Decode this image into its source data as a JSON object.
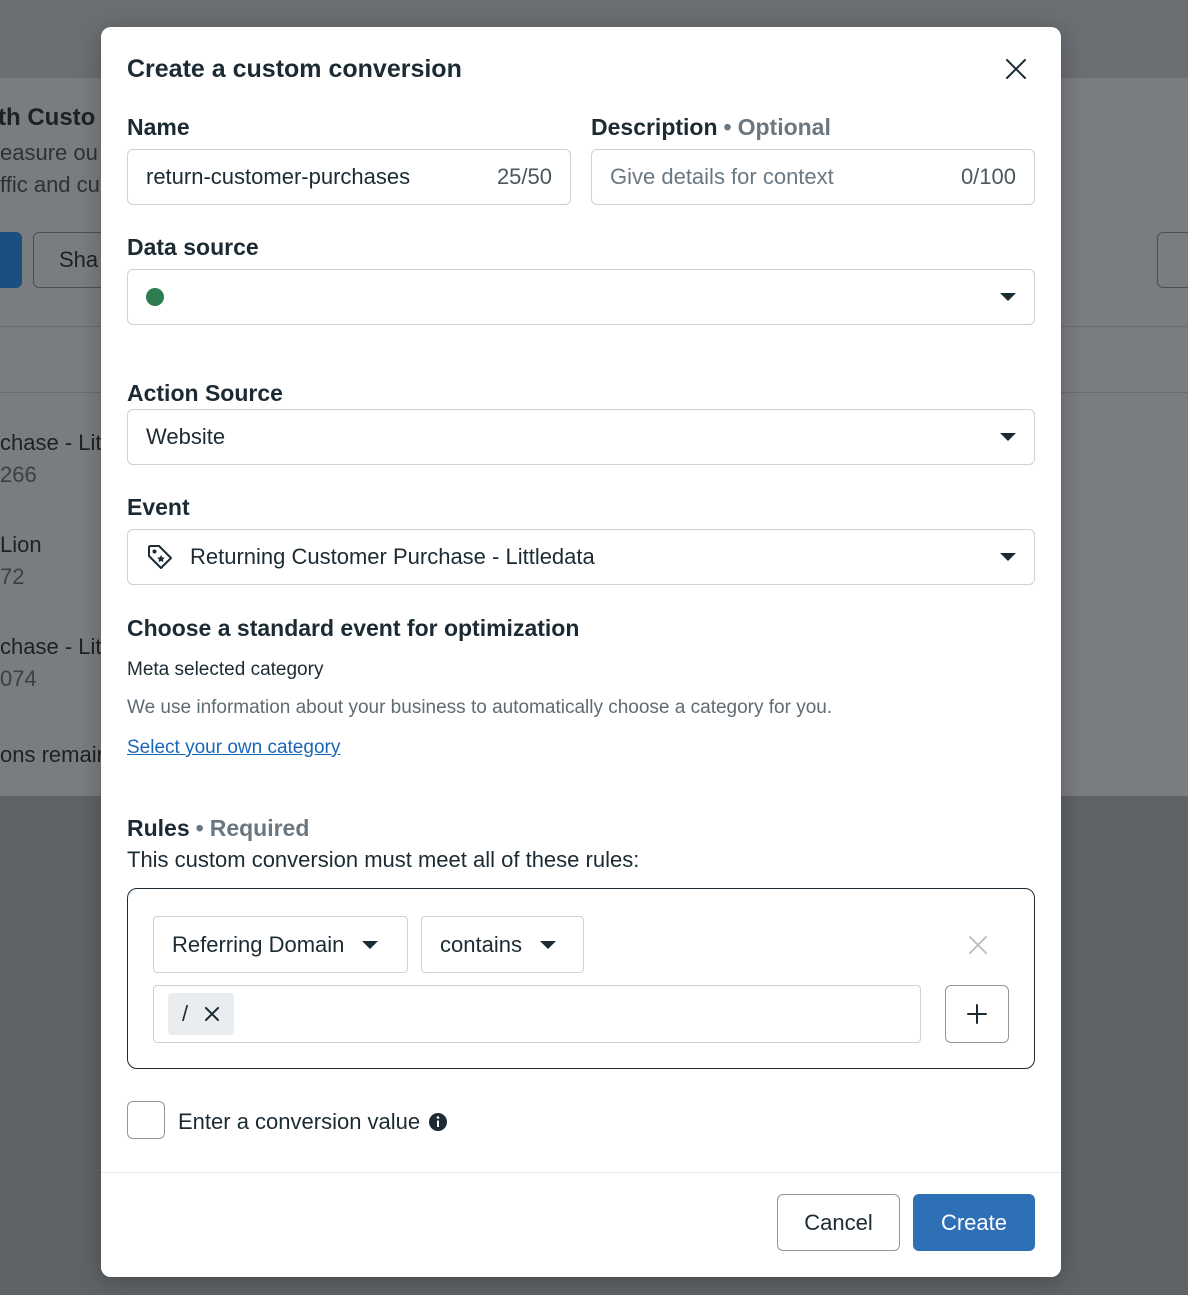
{
  "background": {
    "title_fragment": "th Custo",
    "subtitle_line1": "easure ou",
    "subtitle_line2": "ffic and cu",
    "button_fragment": "Sha",
    "rows": [
      {
        "name": "chase - Lit",
        "id": "266"
      },
      {
        "name": "Lion",
        "id": "72"
      },
      {
        "name": "chase - Lit",
        "id": "074"
      }
    ],
    "remaining_text": "ons remair"
  },
  "modal": {
    "title": "Create a custom conversion",
    "close_icon": "close-icon",
    "name": {
      "label": "Name",
      "value": "return-customer-purchases",
      "counter": "25/50"
    },
    "description": {
      "label": "Description",
      "optional": "Optional",
      "placeholder": "Give details for context",
      "counter": "0/100"
    },
    "data_source": {
      "label": "Data source",
      "status_color": "#2e7d51"
    },
    "action_source": {
      "label": "Action Source",
      "value": "Website"
    },
    "event": {
      "label": "Event",
      "value": "Returning Customer Purchase - Littledata",
      "icon": "tag-icon"
    },
    "optimization": {
      "title": "Choose a standard event for optimization",
      "category_label": "Meta selected category",
      "category_help": "We use information about your business to automatically choose a category for you.",
      "link": "Select your own category"
    },
    "rules": {
      "label": "Rules",
      "required": "Required",
      "description": "This custom conversion must meet all of these rules:",
      "field": "Referring Domain",
      "operator": "contains",
      "chip": "/"
    },
    "conversion_value": {
      "label": "Enter a conversion value"
    },
    "footer": {
      "cancel": "Cancel",
      "create": "Create"
    }
  },
  "colors": {
    "primary": "#2d70b5",
    "link": "#1a66b8",
    "text": "#1c2b33"
  }
}
